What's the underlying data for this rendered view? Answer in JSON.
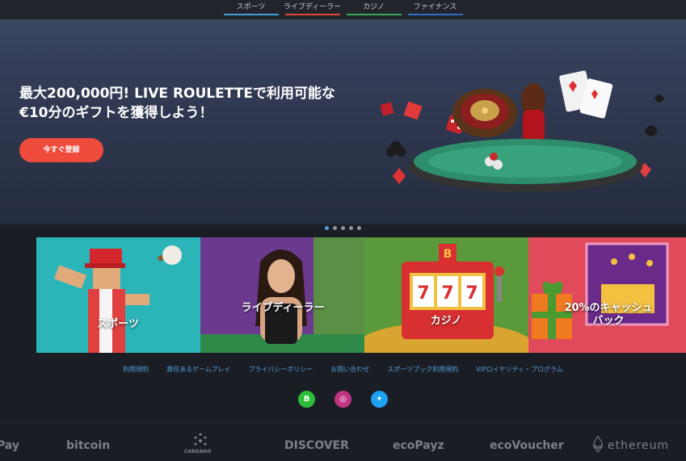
{
  "topnav": {
    "tabs": [
      {
        "label": "スポーツ",
        "color": "#3ea1dc"
      },
      {
        "label": "ライブディーラー",
        "color": "#e0443a"
      },
      {
        "label": "カジノ",
        "color": "#3aa75b"
      },
      {
        "label": "ファイナンス",
        "color": "#2e6fc9"
      }
    ]
  },
  "hero": {
    "headline": "最大200,000円! LIVE ROULETTEで利用可能な€10分のギフトを獲得しよう！",
    "cta_label": "今すぐ登録",
    "slides_count": 5,
    "active_slide": 1
  },
  "tiles": [
    {
      "label": "スポーツ",
      "bg": "#2bb5b8"
    },
    {
      "label": "ライブディーラー",
      "bg": "#6b3a8f"
    },
    {
      "label": "カジノ",
      "bg": "#5a9a3a"
    },
    {
      "label": "20%のキャッシュバック",
      "bg": "#e04a5a"
    }
  ],
  "footer": {
    "links": [
      "利用規約",
      "責任あるゲームプレイ",
      "プライバシーポリシー",
      "お問い合わせ",
      "スポーツブック利用規約",
      "VIPロイヤリティ・プログラム"
    ],
    "social": [
      {
        "name": "b-logo",
        "glyph": "B",
        "color": "#2dbd3a"
      },
      {
        "name": "instagram",
        "glyph": "◎",
        "color": "#c13584"
      },
      {
        "name": "twitter",
        "glyph": "✦",
        "color": "#1da1f2"
      }
    ]
  },
  "payments": [
    "Pay",
    "bitcoin",
    "CARDANO",
    "DISCOVER",
    "ecoPayz",
    "ecoVoucher",
    "ethereum"
  ]
}
